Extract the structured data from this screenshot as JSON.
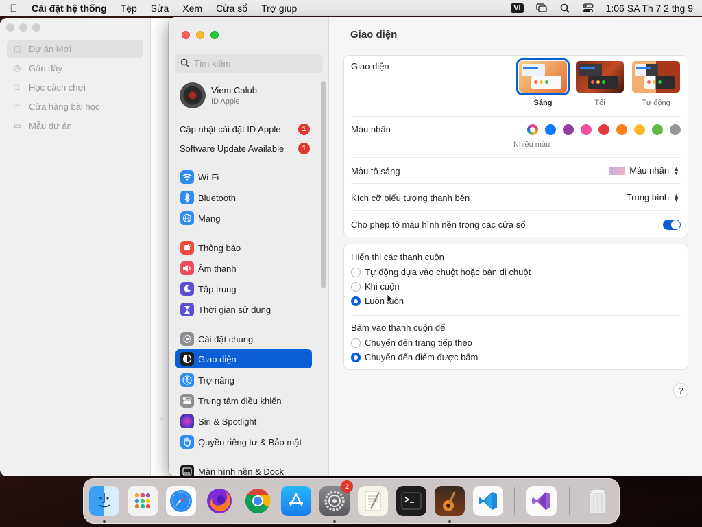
{
  "menubar": {
    "app_name": "Cài đặt hệ thống",
    "items": [
      "Tệp",
      "Sửa",
      "Xem",
      "Cửa sổ",
      "Trợ giúp"
    ],
    "input_source": "VI",
    "clock": "1:06 SA Th 7 2 thg 9"
  },
  "back_window": {
    "items": [
      "Dự án Mới",
      "Gần đây",
      "Học cách chơi",
      "Cửa hàng bài học",
      "Mẫu dự án"
    ]
  },
  "sidebar": {
    "search_placeholder": "Tìm kiếm",
    "user_name": "Viem Calub",
    "user_sub": "ID Apple",
    "notifications": [
      {
        "label": "Cập nhật cài đặt ID Apple",
        "badge": "1"
      },
      {
        "label": "Software Update Available",
        "badge": "1"
      }
    ],
    "items": [
      {
        "label": "Wi-Fi",
        "icon": "wifi-icon",
        "color": "#2f8cf0"
      },
      {
        "label": "Bluetooth",
        "icon": "bluetooth-icon",
        "color": "#2f8cf0"
      },
      {
        "label": "Mạng",
        "icon": "globe-icon",
        "color": "#2f8cf0"
      },
      {
        "label": "Thông báo",
        "icon": "bell-icon",
        "color": "#ef4b3f"
      },
      {
        "label": "Âm thanh",
        "icon": "speaker-icon",
        "color": "#ef4b5f"
      },
      {
        "label": "Tập trung",
        "icon": "moon-icon",
        "color": "#5b4fd6"
      },
      {
        "label": "Thời gian sử dụng",
        "icon": "hourglass-icon",
        "color": "#5b4fd6"
      },
      {
        "label": "Cài đặt chung",
        "icon": "gear-icon",
        "color": "#8e8e93"
      },
      {
        "label": "Giao diện",
        "icon": "appearance-icon",
        "color": "#1c1c1e"
      },
      {
        "label": "Trợ năng",
        "icon": "accessibility-icon",
        "color": "#2f8cf0"
      },
      {
        "label": "Trung tâm điều khiển",
        "icon": "control-center-icon",
        "color": "#8e8e93"
      },
      {
        "label": "Siri & Spotlight",
        "icon": "siri-icon",
        "color": "#7a3fd0"
      },
      {
        "label": "Quyền riêng tư & Bảo mật",
        "icon": "hand-icon",
        "color": "#2f8cf0"
      },
      {
        "label": "Màn hình nền & Dock",
        "icon": "dock-icon",
        "color": "#1c1c1e"
      }
    ]
  },
  "main": {
    "title": "Giao diện",
    "appearance_label": "Giao diện",
    "appearance_options": [
      "Sáng",
      "Tối",
      "Tự động"
    ],
    "accent_label": "Màu nhấn",
    "accent_multi_label": "Nhiều màu",
    "accent_colors": [
      "#0a7aff",
      "#953ca6",
      "#f74f9e",
      "#e0383e",
      "#f7821b",
      "#fcb827",
      "#62ba46",
      "#989898"
    ],
    "highlight_label": "Màu tô sáng",
    "highlight_value": "Màu nhấn",
    "sidebar_icon_label": "Kích cỡ biểu tượng thanh bên",
    "sidebar_icon_value": "Trung bình",
    "wallpaper_tint_label": "Cho phép tô màu hình nền trong các cửa sổ",
    "scrollbars_label": "Hiển thị các thanh cuộn",
    "scroll_options": [
      "Tự động dựa vào chuột hoặc bàn di chuột",
      "Khi cuộn",
      "Luôn luôn"
    ],
    "click_label": "Bấm vào thanh cuộn để",
    "click_options": [
      "Chuyển đến trang tiếp theo",
      "Chuyển đến điểm được bấm"
    ],
    "help": "?"
  },
  "dock": {
    "settings_badge": "2"
  }
}
